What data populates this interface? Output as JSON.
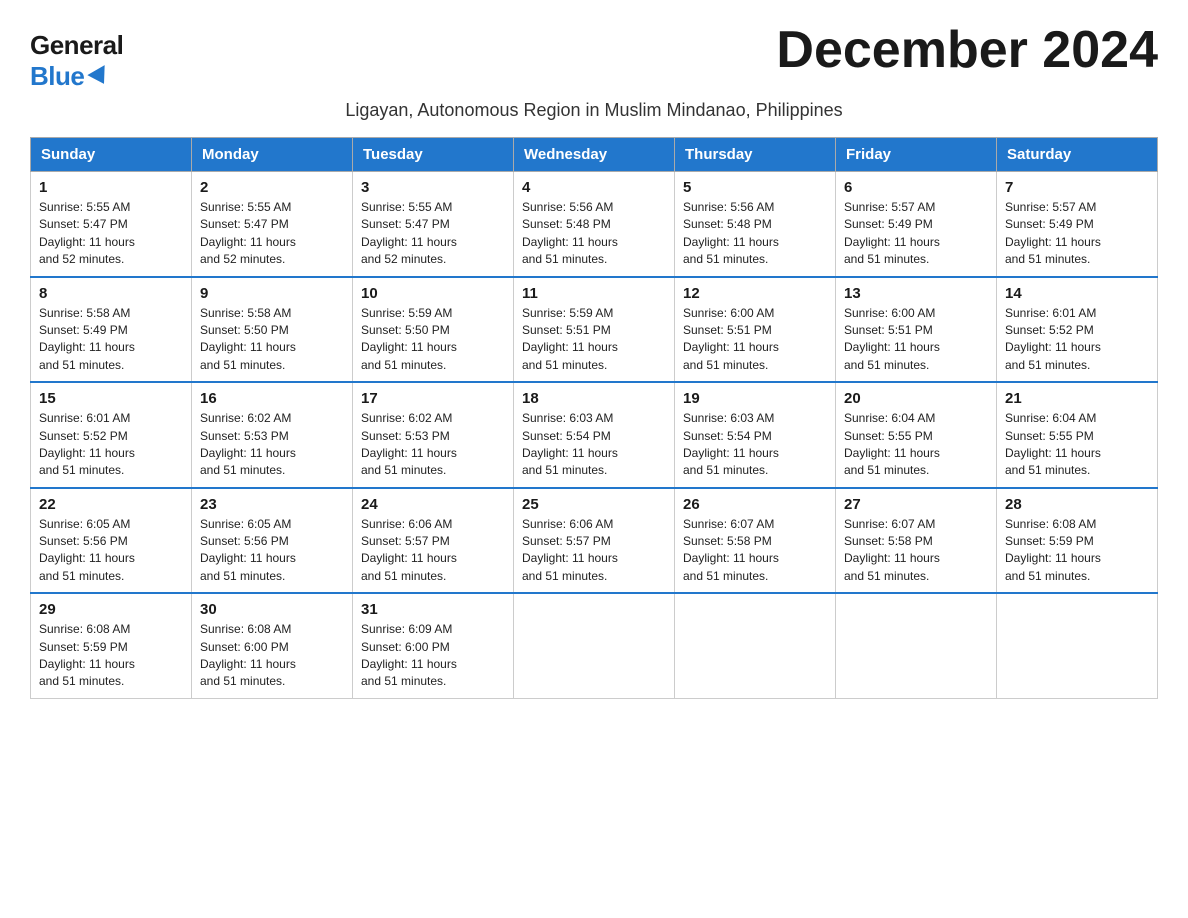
{
  "logo": {
    "general": "General",
    "blue": "Blue"
  },
  "title": "December 2024",
  "subtitle": "Ligayan, Autonomous Region in Muslim Mindanao, Philippines",
  "headers": [
    "Sunday",
    "Monday",
    "Tuesday",
    "Wednesday",
    "Thursday",
    "Friday",
    "Saturday"
  ],
  "weeks": [
    [
      {
        "day": "1",
        "info": "Sunrise: 5:55 AM\nSunset: 5:47 PM\nDaylight: 11 hours\nand 52 minutes."
      },
      {
        "day": "2",
        "info": "Sunrise: 5:55 AM\nSunset: 5:47 PM\nDaylight: 11 hours\nand 52 minutes."
      },
      {
        "day": "3",
        "info": "Sunrise: 5:55 AM\nSunset: 5:47 PM\nDaylight: 11 hours\nand 52 minutes."
      },
      {
        "day": "4",
        "info": "Sunrise: 5:56 AM\nSunset: 5:48 PM\nDaylight: 11 hours\nand 51 minutes."
      },
      {
        "day": "5",
        "info": "Sunrise: 5:56 AM\nSunset: 5:48 PM\nDaylight: 11 hours\nand 51 minutes."
      },
      {
        "day": "6",
        "info": "Sunrise: 5:57 AM\nSunset: 5:49 PM\nDaylight: 11 hours\nand 51 minutes."
      },
      {
        "day": "7",
        "info": "Sunrise: 5:57 AM\nSunset: 5:49 PM\nDaylight: 11 hours\nand 51 minutes."
      }
    ],
    [
      {
        "day": "8",
        "info": "Sunrise: 5:58 AM\nSunset: 5:49 PM\nDaylight: 11 hours\nand 51 minutes."
      },
      {
        "day": "9",
        "info": "Sunrise: 5:58 AM\nSunset: 5:50 PM\nDaylight: 11 hours\nand 51 minutes."
      },
      {
        "day": "10",
        "info": "Sunrise: 5:59 AM\nSunset: 5:50 PM\nDaylight: 11 hours\nand 51 minutes."
      },
      {
        "day": "11",
        "info": "Sunrise: 5:59 AM\nSunset: 5:51 PM\nDaylight: 11 hours\nand 51 minutes."
      },
      {
        "day": "12",
        "info": "Sunrise: 6:00 AM\nSunset: 5:51 PM\nDaylight: 11 hours\nand 51 minutes."
      },
      {
        "day": "13",
        "info": "Sunrise: 6:00 AM\nSunset: 5:51 PM\nDaylight: 11 hours\nand 51 minutes."
      },
      {
        "day": "14",
        "info": "Sunrise: 6:01 AM\nSunset: 5:52 PM\nDaylight: 11 hours\nand 51 minutes."
      }
    ],
    [
      {
        "day": "15",
        "info": "Sunrise: 6:01 AM\nSunset: 5:52 PM\nDaylight: 11 hours\nand 51 minutes."
      },
      {
        "day": "16",
        "info": "Sunrise: 6:02 AM\nSunset: 5:53 PM\nDaylight: 11 hours\nand 51 minutes."
      },
      {
        "day": "17",
        "info": "Sunrise: 6:02 AM\nSunset: 5:53 PM\nDaylight: 11 hours\nand 51 minutes."
      },
      {
        "day": "18",
        "info": "Sunrise: 6:03 AM\nSunset: 5:54 PM\nDaylight: 11 hours\nand 51 minutes."
      },
      {
        "day": "19",
        "info": "Sunrise: 6:03 AM\nSunset: 5:54 PM\nDaylight: 11 hours\nand 51 minutes."
      },
      {
        "day": "20",
        "info": "Sunrise: 6:04 AM\nSunset: 5:55 PM\nDaylight: 11 hours\nand 51 minutes."
      },
      {
        "day": "21",
        "info": "Sunrise: 6:04 AM\nSunset: 5:55 PM\nDaylight: 11 hours\nand 51 minutes."
      }
    ],
    [
      {
        "day": "22",
        "info": "Sunrise: 6:05 AM\nSunset: 5:56 PM\nDaylight: 11 hours\nand 51 minutes."
      },
      {
        "day": "23",
        "info": "Sunrise: 6:05 AM\nSunset: 5:56 PM\nDaylight: 11 hours\nand 51 minutes."
      },
      {
        "day": "24",
        "info": "Sunrise: 6:06 AM\nSunset: 5:57 PM\nDaylight: 11 hours\nand 51 minutes."
      },
      {
        "day": "25",
        "info": "Sunrise: 6:06 AM\nSunset: 5:57 PM\nDaylight: 11 hours\nand 51 minutes."
      },
      {
        "day": "26",
        "info": "Sunrise: 6:07 AM\nSunset: 5:58 PM\nDaylight: 11 hours\nand 51 minutes."
      },
      {
        "day": "27",
        "info": "Sunrise: 6:07 AM\nSunset: 5:58 PM\nDaylight: 11 hours\nand 51 minutes."
      },
      {
        "day": "28",
        "info": "Sunrise: 6:08 AM\nSunset: 5:59 PM\nDaylight: 11 hours\nand 51 minutes."
      }
    ],
    [
      {
        "day": "29",
        "info": "Sunrise: 6:08 AM\nSunset: 5:59 PM\nDaylight: 11 hours\nand 51 minutes."
      },
      {
        "day": "30",
        "info": "Sunrise: 6:08 AM\nSunset: 6:00 PM\nDaylight: 11 hours\nand 51 minutes."
      },
      {
        "day": "31",
        "info": "Sunrise: 6:09 AM\nSunset: 6:00 PM\nDaylight: 11 hours\nand 51 minutes."
      },
      {
        "day": "",
        "info": ""
      },
      {
        "day": "",
        "info": ""
      },
      {
        "day": "",
        "info": ""
      },
      {
        "day": "",
        "info": ""
      }
    ]
  ]
}
